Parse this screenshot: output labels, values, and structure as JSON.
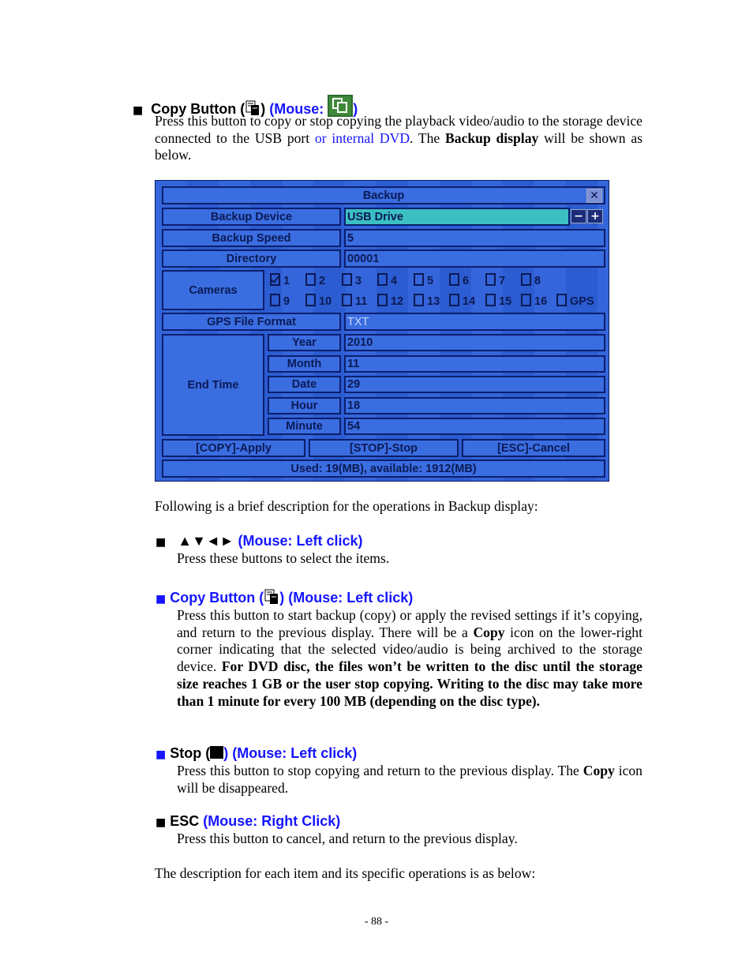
{
  "section1": {
    "title": "Copy Button (",
    "title_close": ")",
    "mouse_label": "(Mouse:",
    "mouse_close": ")",
    "icons": {
      "copy": "copy-document-icon",
      "mouse_copy": "mouse-copy-green-icon"
    },
    "para": [
      "Press this button to copy or stop copying the playback video/audio to the storage device connected to the USB port ",
      "or internal DVD",
      ".    The ",
      "Backup display",
      " will be shown as below."
    ]
  },
  "dialog": {
    "title": "Backup",
    "close_icon": "close-x-icon",
    "rows": {
      "backup_device": {
        "label": "Backup Device",
        "value": "USB Drive"
      },
      "backup_speed": {
        "label": "Backup Speed",
        "value": "5"
      },
      "directory": {
        "label": "Directory",
        "value": "00001"
      },
      "gps_file_format": {
        "label": "GPS File Format",
        "value": "TXT"
      }
    },
    "minus": "−",
    "plus": "+",
    "cameras": {
      "label": "Cameras",
      "items": [
        {
          "label": "1",
          "checked": true
        },
        {
          "label": "2",
          "checked": false
        },
        {
          "label": "3",
          "checked": false
        },
        {
          "label": "4",
          "checked": false
        },
        {
          "label": "5",
          "checked": false
        },
        {
          "label": "6",
          "checked": false
        },
        {
          "label": "7",
          "checked": false
        },
        {
          "label": "8",
          "checked": false
        },
        {
          "label": "9",
          "checked": false
        },
        {
          "label": "10",
          "checked": false
        },
        {
          "label": "11",
          "checked": false
        },
        {
          "label": "12",
          "checked": false
        },
        {
          "label": "13",
          "checked": false
        },
        {
          "label": "14",
          "checked": false
        },
        {
          "label": "15",
          "checked": false
        },
        {
          "label": "16",
          "checked": false
        },
        {
          "label": "GPS",
          "checked": false
        }
      ]
    },
    "end_time": {
      "label": "End Time",
      "fields": [
        {
          "label": "Year",
          "value": "2010"
        },
        {
          "label": "Month",
          "value": "11"
        },
        {
          "label": "Date",
          "value": "29"
        },
        {
          "label": "Hour",
          "value": "18"
        },
        {
          "label": "Minute",
          "value": "54"
        }
      ]
    },
    "buttons": {
      "apply": "[COPY]-Apply",
      "stop": "[STOP]-Stop",
      "cancel": "[ESC]-Cancel"
    },
    "status": "Used: 19(MB), available: 1912(MB)"
  },
  "following": "Following is a brief description for the operations in Backup display:",
  "arrows": {
    "symbols": "▲▼◄►",
    "mouse": "(Mouse: Left click)",
    "text": "Press these buttons to select the items."
  },
  "copy": {
    "title": "Copy Button (",
    "title_close": ") (Mouse: Left click)",
    "para": [
      "Press this button to start backup (copy) or apply the revised settings if it’s copying, and return to the previous display.   There will be a ",
      "Copy",
      " icon on the lower-right corner indicating that the selected video/audio is being archived to the storage device.   ",
      "For DVD disc, the files won’t be written to the disc until the storage size reaches 1 GB or the user stop copying. Writing to the disc may take more than 1 minute for every 100 MB (depending on the disc type)."
    ]
  },
  "stop": {
    "title": "Stop (",
    "title_close": ") (Mouse: Left click)",
    "icon": "stop-square-icon",
    "para": [
      "Press this button to stop copying and return to the previous display.   The ",
      "Copy",
      " icon will be disappeared."
    ]
  },
  "esc": {
    "title": "ESC",
    "mouse": "(Mouse: Right Click)",
    "text": "Press this button to cancel, and return to the previous display."
  },
  "closing": "The description for each item and its specific operations is as below:",
  "page_number": "- 88 -"
}
